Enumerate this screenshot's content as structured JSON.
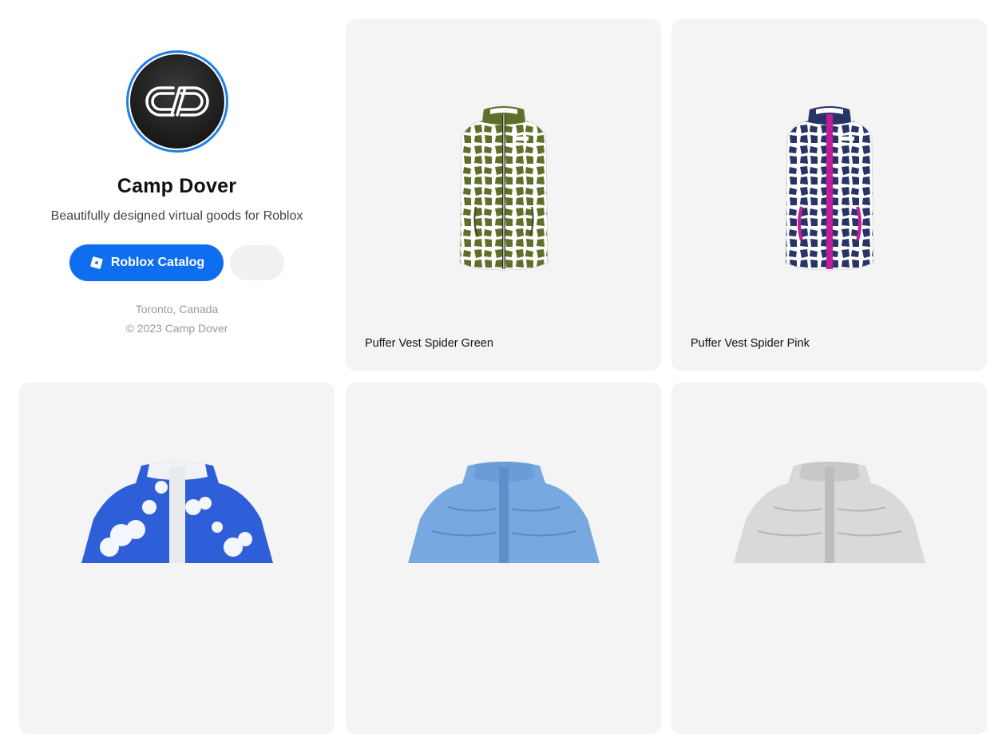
{
  "profile": {
    "name": "Camp Dover",
    "tagline": "Beautifully designed virtual goods for Roblox",
    "catalog_button": "Roblox Catalog",
    "location": "Toronto, Canada",
    "copyright": "© 2023 Camp Dover",
    "accent_color": "#0f6ef0"
  },
  "products": [
    {
      "title": "Puffer Vest Spider Green",
      "icon": "green-puffer-vest"
    },
    {
      "title": "Puffer Vest Spider Pink",
      "icon": "navy-pink-puffer-vest"
    },
    {
      "title": "",
      "icon": "cloud-print-puffer-jacket"
    },
    {
      "title": "",
      "icon": "light-blue-puffer-jacket"
    },
    {
      "title": "",
      "icon": "silver-puffer-jacket"
    }
  ]
}
